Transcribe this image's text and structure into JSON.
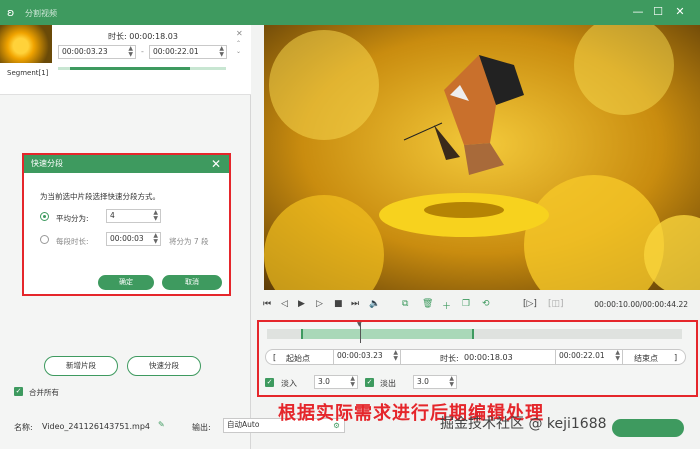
{
  "window": {
    "title": "分割视频",
    "controls": [
      "—",
      "☐",
      "✕"
    ]
  },
  "segment": {
    "name": "Segment[1]",
    "duration_label": "时长:",
    "duration_value": "00:00:18.03",
    "start_time": "00:00:03.23",
    "end_time": "00:00:22.01",
    "separator": "-"
  },
  "dialog": {
    "title": "快速分段",
    "description": "为当前选中片段选择快速分段方式。",
    "option_avg_label": "平均分为:",
    "option_avg_value": "4",
    "option_time_label": "每段时长:",
    "option_time_value": "00:00:03",
    "option_time_result": "将分为 7 段",
    "ok_label": "确定",
    "cancel_label": "取消"
  },
  "left_actions": {
    "new_segment": "新增片段",
    "quick_split": "快速分段",
    "merge_all": "合并所有"
  },
  "playback": {
    "timecode": "00:00:10.00/00:00:44.22"
  },
  "editor": {
    "start_btn": "起始点",
    "start_time": "00:00:03.23",
    "duration_label": "时长:",
    "duration_value": "00:00:18.03",
    "end_time": "00:00:22.01",
    "end_btn": "结束点",
    "fade_in_label": "淡入",
    "fade_in_value": "3.0",
    "fade_out_label": "淡出",
    "fade_out_value": "3.0"
  },
  "annotation": "根据实际需求进行后期编辑处理",
  "watermark": "掘金技术社区 @ keji1688",
  "footer": {
    "name_label": "名称:",
    "file_name": "Video_241126143751.mp4",
    "output_label": "输出:",
    "output_value": "自动Auto"
  },
  "colors": {
    "accent": "#3e9a5f",
    "highlight": "#e5262b"
  }
}
